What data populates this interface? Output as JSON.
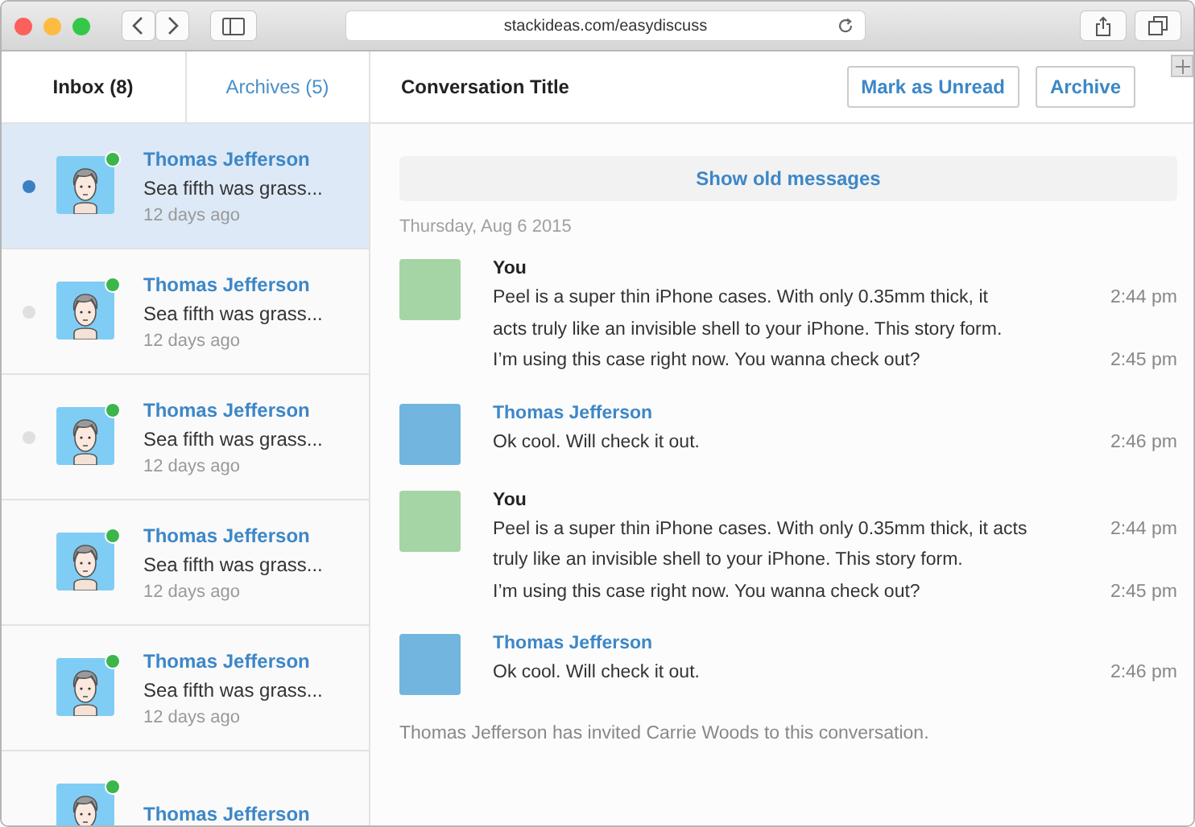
{
  "browser": {
    "url": "stackideas.com/easydiscuss"
  },
  "tabs": [
    {
      "label": "Inbox (8)",
      "selected": true
    },
    {
      "label": "Archives (5)",
      "selected": false
    }
  ],
  "conversations": [
    {
      "name": "Thomas Jefferson",
      "preview": "Sea fifth was grass...",
      "time": "12 days ago",
      "selected": true,
      "marker": true,
      "online": true
    },
    {
      "name": "Thomas Jefferson",
      "preview": "Sea fifth was grass...",
      "time": "12 days ago",
      "selected": false,
      "marker": true,
      "online": true
    },
    {
      "name": "Thomas Jefferson",
      "preview": "Sea fifth was grass...",
      "time": "12 days ago",
      "selected": false,
      "marker": true,
      "online": true
    },
    {
      "name": "Thomas Jefferson",
      "preview": "Sea fifth was grass...",
      "time": "12 days ago",
      "selected": false,
      "marker": false,
      "online": true
    },
    {
      "name": "Thomas Jefferson",
      "preview": "Sea fifth was grass...",
      "time": "12 days ago",
      "selected": false,
      "marker": false,
      "online": true
    },
    {
      "name": "Thomas Jefferson",
      "selected": false,
      "marker": false,
      "online": true
    }
  ],
  "conversation": {
    "title": "Conversation Title",
    "buttons": [
      "Mark as Unread",
      "Archive"
    ],
    "show_old": "Show old messages",
    "date": "Thursday, Aug 6 2015",
    "messages": [
      {
        "kind": "self",
        "sender": "You",
        "lines": [
          {
            "text": "Peel is a super thin iPhone cases. With only 0.35mm thick, it",
            "time": "2:44 pm"
          },
          {
            "text": "acts truly like an invisible shell to your iPhone. This story form."
          },
          {
            "text": "I’m using this case right now. You wanna check out?",
            "time": "2:45 pm"
          }
        ]
      },
      {
        "kind": "other",
        "sender": "Thomas Jefferson",
        "lines": [
          {
            "text": "Ok cool. Will check it out.",
            "time": "2:46 pm"
          }
        ]
      },
      {
        "kind": "self",
        "sender": "You",
        "lines": [
          {
            "text": "Peel is a super thin iPhone cases. With only 0.35mm thick, it acts",
            "time": "2:44 pm"
          },
          {
            "text": "truly like an invisible shell to your iPhone. This story form."
          },
          {
            "text": "I’m using this case right now. You wanna check out?",
            "time": "2:45 pm"
          }
        ]
      },
      {
        "kind": "other",
        "sender": "Thomas Jefferson",
        "lines": [
          {
            "text": "Ok cool. Will check it out.",
            "time": "2:46 pm"
          }
        ]
      }
    ],
    "notice": "Thomas Jefferson has invited Carrie Woods to this conversation."
  }
}
